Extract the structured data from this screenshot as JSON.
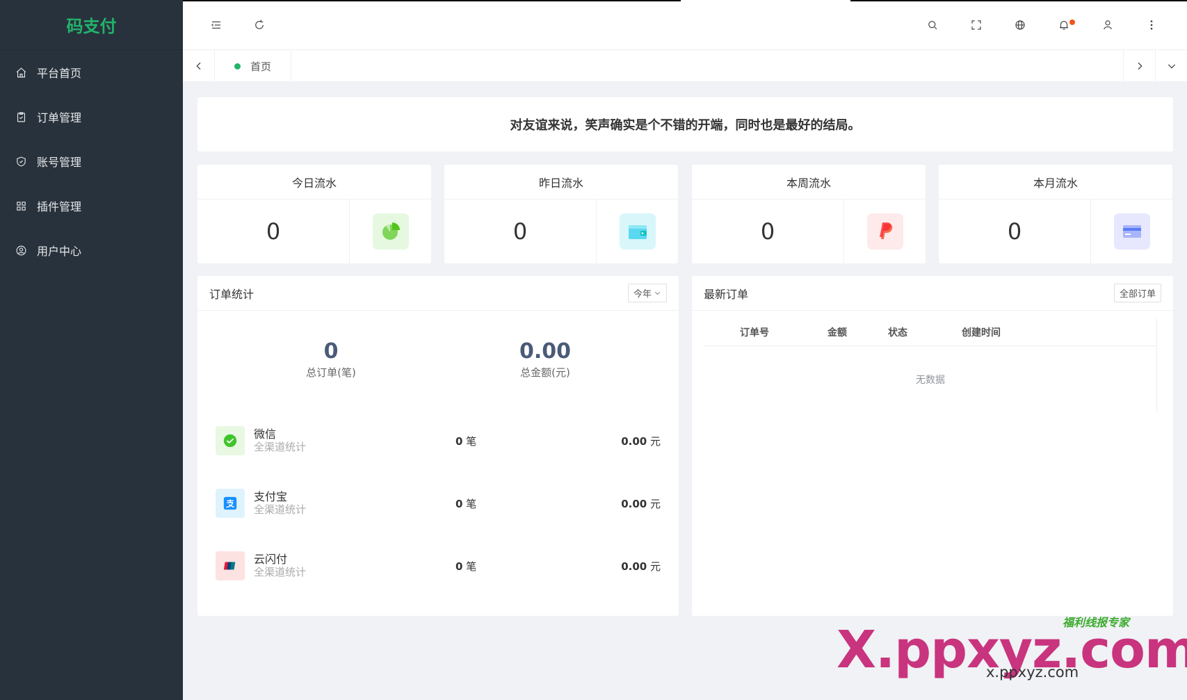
{
  "app": {
    "logo": "码支付"
  },
  "sidebar": {
    "items": [
      {
        "label": "平台首页",
        "icon": "home-icon"
      },
      {
        "label": "订单管理",
        "icon": "clipboard-icon"
      },
      {
        "label": "账号管理",
        "icon": "shield-icon"
      },
      {
        "label": "插件管理",
        "icon": "grid-icon"
      },
      {
        "label": "用户中心",
        "icon": "user-circle-icon"
      }
    ]
  },
  "tabs": {
    "home_label": "首页"
  },
  "motto": "对友谊来说，笑声确实是个不错的开端，同时也是最好的结局。",
  "stats": [
    {
      "title": "今日流水",
      "value": "0",
      "icon": "pie-chart-icon",
      "color": "#52c41a"
    },
    {
      "title": "昨日流水",
      "value": "0",
      "icon": "wallet-icon",
      "color": "#13c2c2"
    },
    {
      "title": "本周流水",
      "value": "0",
      "icon": "paypal-icon",
      "color": "#f5222d"
    },
    {
      "title": "本月流水",
      "value": "0",
      "icon": "card-icon",
      "color": "#597ef7"
    }
  ],
  "orders": {
    "title": "订单统计",
    "filter": "今年",
    "total_orders": "0",
    "total_orders_label": "总订单(笔)",
    "total_amount": "0.00",
    "total_amount_label": "总金额(元)",
    "channels": [
      {
        "name": "微信",
        "sub": "全渠道统计",
        "count": "0",
        "count_unit": "笔",
        "amount": "0.00",
        "amount_unit": "元",
        "icon": "wechat-icon"
      },
      {
        "name": "支付宝",
        "sub": "全渠道统计",
        "count": "0",
        "count_unit": "笔",
        "amount": "0.00",
        "amount_unit": "元",
        "icon": "alipay-icon"
      },
      {
        "name": "云闪付",
        "sub": "全渠道统计",
        "count": "0",
        "count_unit": "笔",
        "amount": "0.00",
        "amount_unit": "元",
        "icon": "unionpay-icon"
      }
    ]
  },
  "latest": {
    "title": "最新订单",
    "all_button": "全部订单",
    "columns": [
      "订单号",
      "金额",
      "状态",
      "创建时间"
    ],
    "empty": "无数据"
  },
  "watermark": {
    "main": "X.ppxyz.com",
    "sub": "x.ppxyz.com",
    "top": "福利线报专家"
  }
}
